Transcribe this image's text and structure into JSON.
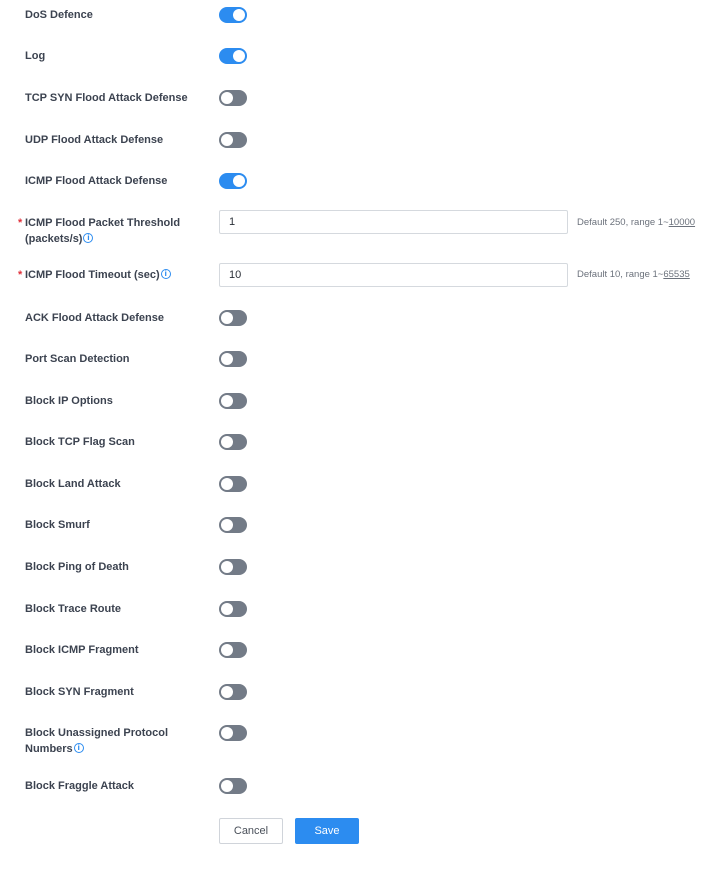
{
  "colors": {
    "accent": "#2c8cf0",
    "toggle_off": "#737b87",
    "required": "#e0303a"
  },
  "rows": [
    {
      "label": "DoS Defence",
      "type": "toggle",
      "on": true
    },
    {
      "label": "Log",
      "type": "toggle",
      "on": true
    },
    {
      "label": "TCP SYN Flood Attack Defense",
      "type": "toggle",
      "on": false
    },
    {
      "label": "UDP Flood Attack Defense",
      "type": "toggle",
      "on": false
    },
    {
      "label": "ICMP Flood Attack Defense",
      "type": "toggle",
      "on": true
    },
    {
      "label": "ICMP Flood Packet Threshold (packets/s)",
      "type": "input",
      "required": true,
      "info": true,
      "value": "1",
      "hint": "Default 250, range 1~",
      "hint_link": "10000"
    },
    {
      "label": "ICMP Flood Timeout (sec)",
      "type": "input",
      "required": true,
      "info": true,
      "value": "10",
      "hint": "Default 10, range 1~",
      "hint_link": "65535"
    },
    {
      "label": "ACK Flood Attack Defense",
      "type": "toggle",
      "on": false
    },
    {
      "label": "Port Scan Detection",
      "type": "toggle",
      "on": false
    },
    {
      "label": "Block IP Options",
      "type": "toggle",
      "on": false
    },
    {
      "label": "Block TCP Flag Scan",
      "type": "toggle",
      "on": false
    },
    {
      "label": "Block Land Attack",
      "type": "toggle",
      "on": false
    },
    {
      "label": "Block Smurf",
      "type": "toggle",
      "on": false
    },
    {
      "label": "Block Ping of Death",
      "type": "toggle",
      "on": false
    },
    {
      "label": "Block Trace Route",
      "type": "toggle",
      "on": false
    },
    {
      "label": "Block ICMP Fragment",
      "type": "toggle",
      "on": false
    },
    {
      "label": "Block SYN Fragment",
      "type": "toggle",
      "on": false
    },
    {
      "label": "Block Unassigned Protocol Numbers",
      "type": "toggle",
      "on": false,
      "info": true
    },
    {
      "label": "Block Fraggle Attack",
      "type": "toggle",
      "on": false
    }
  ],
  "buttons": {
    "cancel": "Cancel",
    "save": "Save"
  },
  "icons": {
    "info": "info-circle-icon",
    "required": "asterisk"
  }
}
